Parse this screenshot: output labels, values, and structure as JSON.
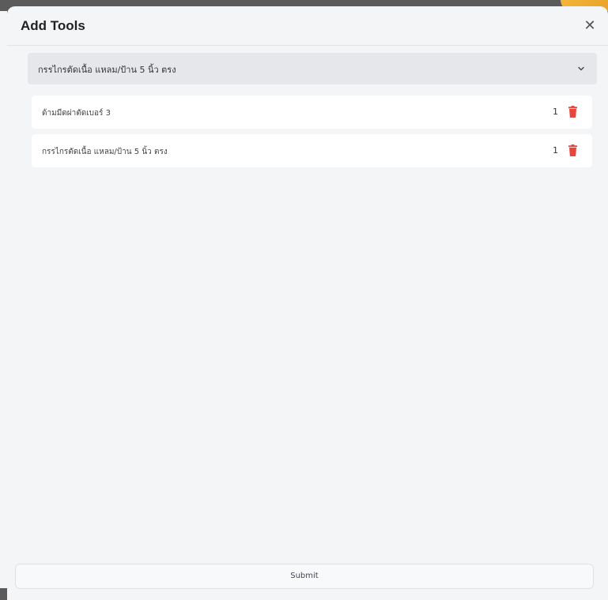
{
  "modal": {
    "title": "Add Tools",
    "close_icon": "close-icon"
  },
  "select": {
    "value": "กรรไกรตัดเนื้อ แหลม/ป้าน 5 นิ้ว ตรง",
    "chevron_icon": "chevron-down-icon"
  },
  "tools": [
    {
      "name": "ด้ามมีดผ่าตัดเบอร์ 3",
      "qty": "1",
      "icon": "trash-icon"
    },
    {
      "name": "กรรไกรตัดเนื้อ แหลม/ป้าน 5 นิ้ว ตรง",
      "qty": "1",
      "icon": "trash-icon"
    }
  ],
  "submit_label": "Submit",
  "colors": {
    "trash": "#e8453c",
    "accent": "#f2b63a"
  }
}
